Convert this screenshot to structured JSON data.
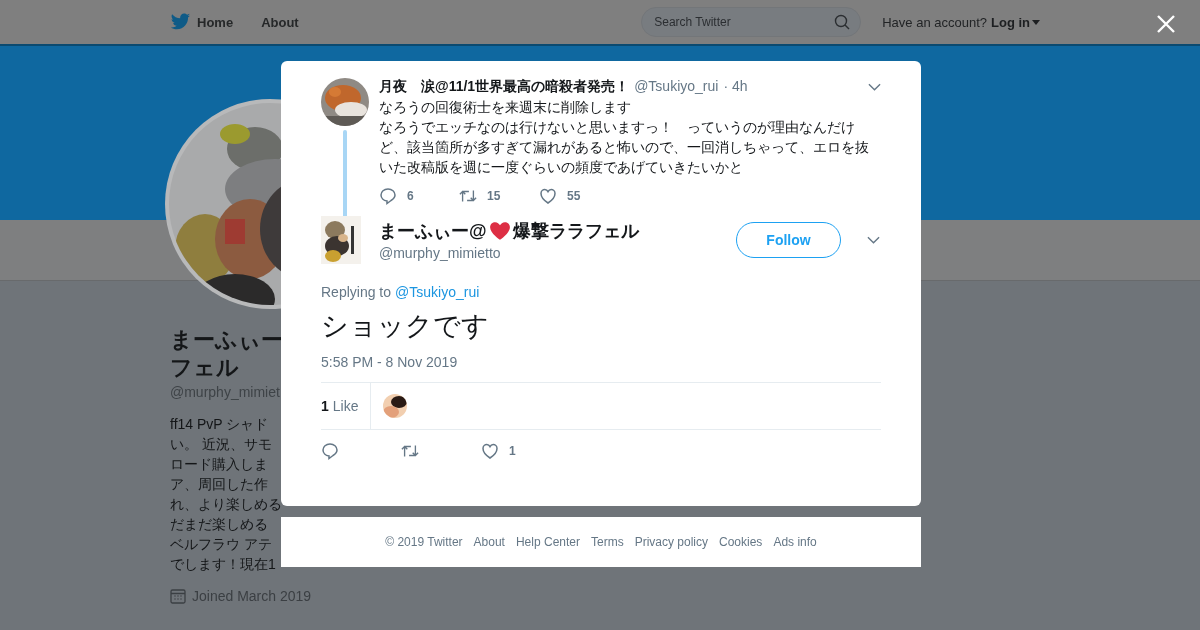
{
  "topbar": {
    "nav": [
      "Home",
      "About"
    ],
    "search": {
      "placeholder": "Search Twitter"
    },
    "account_prompt": "Have an account?",
    "login": "Log in"
  },
  "profile": {
    "name_lines": [
      "まーふぃー",
      "フェル"
    ],
    "handle": "@murphy_mimiet",
    "bio_lines": [
      "ff14 PvP シャド",
      "い。 近況、サモ",
      "ロード購入しま",
      "ア、周回した作",
      "れ、より楽しめる",
      "だまだ楽しめる",
      "ベルフラウ アテ",
      "でします！現在1"
    ],
    "joined": "Joined March 2019"
  },
  "parent_tweet": {
    "name": "月夜　涙@11/1世界最高の暗殺者発売！",
    "handle": "@Tsukiyo_rui",
    "time": "· 4h",
    "text_lines": [
      "なろうの回復術士を来週末に削除します",
      "なろうでエッチなのは行けないと思いますっ！　っていうのが理由なんだけ",
      "ど、該当箇所が多すぎて漏れがあると怖いので、一回消しちゃって、エロを抜",
      "いた改稿版を週に一度ぐらいの頻度であげていきたいかと"
    ],
    "replies": "6",
    "retweets": "15",
    "likes": "55"
  },
  "tweet": {
    "name_before": "まーふぃー@",
    "name_after": "爆撃ララフェル",
    "handle": "@murphy_mimietto",
    "follow": "Follow",
    "replying_label": "Replying to",
    "reply_to": "@Tsukiyo_rui",
    "text": "ショックです",
    "timestamp": "5:58 PM - 8 Nov 2019",
    "like_count": "1",
    "like_label": "Like",
    "likes": "1"
  },
  "footer": [
    "© 2019 Twitter",
    "About",
    "Help Center",
    "Terms",
    "Privacy policy",
    "Cookies",
    "Ads info"
  ]
}
